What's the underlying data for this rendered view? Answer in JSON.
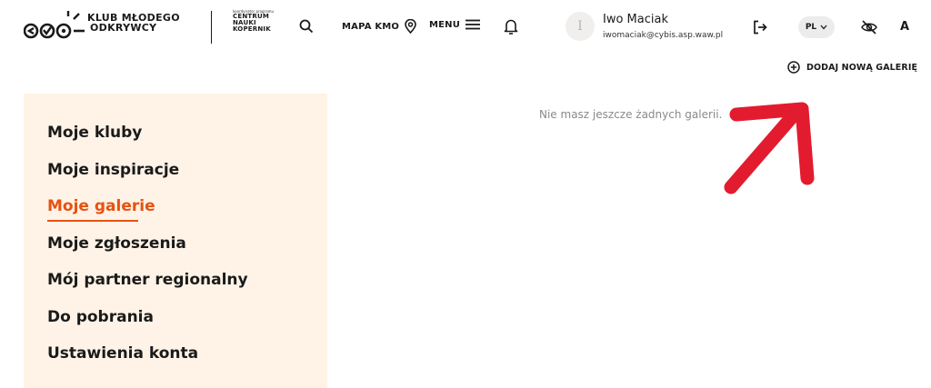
{
  "header": {
    "logo_line1": "KLUB MŁODEGO",
    "logo_line2": "ODKRYWCY",
    "partner_small": "koordynator programu",
    "partner_line1": "CENTRUM",
    "partner_line2": "NAUKI",
    "partner_line3": "KOPERNIK",
    "mapa_label": "MAPA KMO",
    "menu_label": "MENU",
    "user": {
      "initial": "I",
      "name": "Iwo Maciak",
      "email": "iwomaciak@cybis.asp.waw.pl"
    },
    "lang": "PL",
    "font_size_label": "A"
  },
  "toolbar": {
    "add_gallery_label": "DODAJ NOWĄ GALERIĘ"
  },
  "sidebar": {
    "items": [
      {
        "label": "Moje kluby"
      },
      {
        "label": "Moje inspiracje"
      },
      {
        "label": "Moje galerie"
      },
      {
        "label": "Moje zgłoszenia"
      },
      {
        "label": "Mój partner regionalny"
      },
      {
        "label": "Do pobrania"
      },
      {
        "label": "Ustawienia konta"
      }
    ],
    "active_index": 2
  },
  "main": {
    "empty_message": "Nie masz jeszcze żadnych galerii."
  },
  "colors": {
    "accent": "#e8510f",
    "sidebar_bg": "#fff3e7",
    "annotation_arrow": "#e31b2f"
  }
}
